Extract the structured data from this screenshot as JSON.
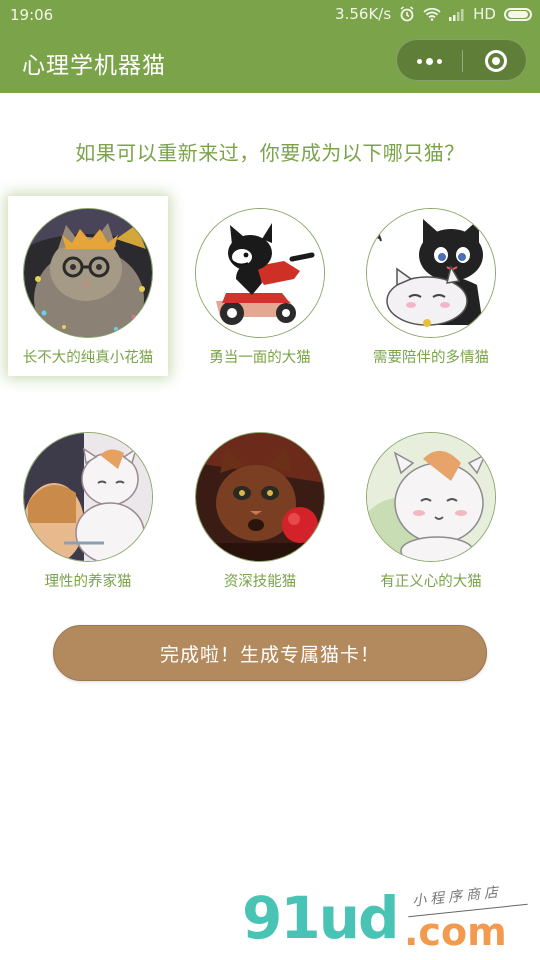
{
  "status_bar": {
    "time": "19:06",
    "speed": "3.56K/s",
    "network": "HD"
  },
  "navbar": {
    "title": "心理学机器猫",
    "more_icon": "more-dots-icon",
    "close_icon": "close-miniprogram-icon"
  },
  "question": "如果可以重新来过，你要成为以下哪只猫？",
  "cats": [
    {
      "label": "长不大的纯真小花猫",
      "selected": true
    },
    {
      "label": "勇当一面的大猫",
      "selected": false
    },
    {
      "label": "需要陪伴的多情猫",
      "selected": false
    },
    {
      "label": "理性的养家猫",
      "selected": false
    },
    {
      "label": "资深技能猫",
      "selected": false
    },
    {
      "label": "有正义心的大猫",
      "selected": false
    }
  ],
  "finish_button": "完成啦！生成专属猫卡！",
  "watermark": {
    "brand": "91ud",
    "suffix": ".com",
    "tagline": "小程序商店"
  },
  "colors": {
    "accent": "#7aa34a",
    "button": "#b38a5e",
    "brand_teal": "#49c3b3",
    "brand_orange": "#f29a4e"
  }
}
